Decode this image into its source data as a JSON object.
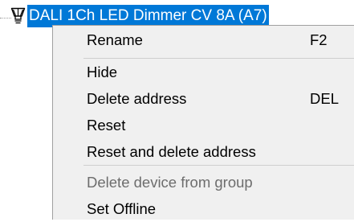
{
  "tree": {
    "node_icon": "lamp-icon",
    "node_label": "DALI 1Ch LED Dimmer CV 8A (A7)",
    "selection_color": "#0078d7"
  },
  "context_menu": {
    "items": [
      {
        "label": "Rename",
        "shortcut": "F2",
        "enabled": true
      },
      {
        "label": "Hide",
        "shortcut": "",
        "enabled": true
      },
      {
        "label": "Delete address",
        "shortcut": "DEL",
        "enabled": true
      },
      {
        "label": "Reset",
        "shortcut": "",
        "enabled": true
      },
      {
        "label": "Reset and delete address",
        "shortcut": "",
        "enabled": true
      },
      {
        "label": "Delete device from group",
        "shortcut": "",
        "enabled": false
      },
      {
        "label": "Set Offline",
        "shortcut": "",
        "enabled": true
      }
    ]
  }
}
